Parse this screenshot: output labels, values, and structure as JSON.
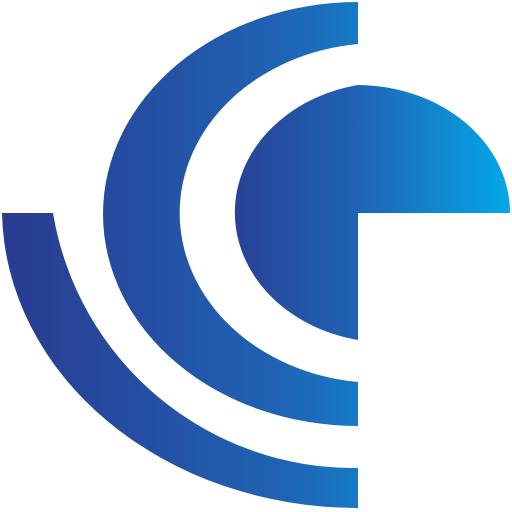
{
  "logo": {
    "colors": {
      "dark_blue": "#2a3a8f",
      "mid_blue": "#1f63b4",
      "light_blue": "#02a8e8",
      "background": "#ffffff"
    },
    "icon": "abstract-c-arc-logo-icon"
  }
}
